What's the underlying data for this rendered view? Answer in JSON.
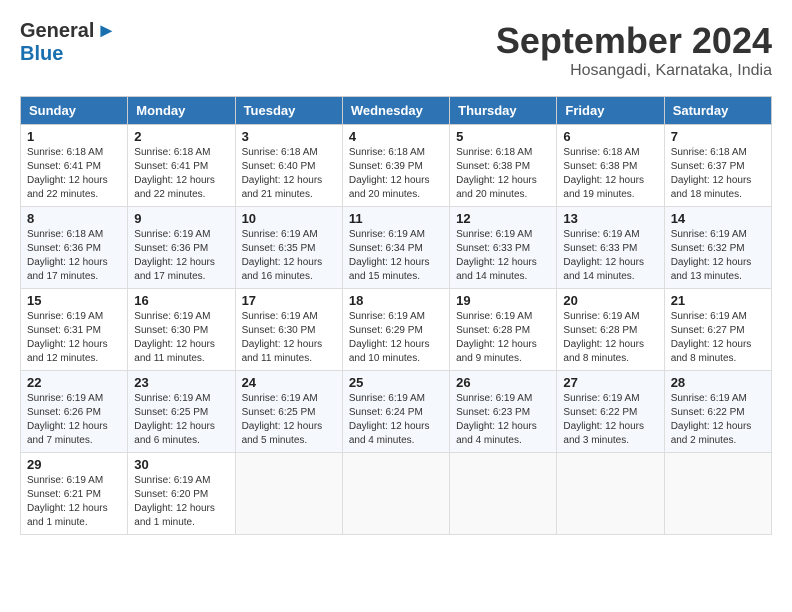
{
  "logo": {
    "general": "General",
    "blue": "Blue"
  },
  "title": "September 2024",
  "location": "Hosangadi, Karnataka, India",
  "headers": [
    "Sunday",
    "Monday",
    "Tuesday",
    "Wednesday",
    "Thursday",
    "Friday",
    "Saturday"
  ],
  "weeks": [
    [
      {
        "day": "1",
        "sunrise": "6:18 AM",
        "sunset": "6:41 PM",
        "daylight": "12 hours and 22 minutes."
      },
      {
        "day": "2",
        "sunrise": "6:18 AM",
        "sunset": "6:41 PM",
        "daylight": "12 hours and 22 minutes."
      },
      {
        "day": "3",
        "sunrise": "6:18 AM",
        "sunset": "6:40 PM",
        "daylight": "12 hours and 21 minutes."
      },
      {
        "day": "4",
        "sunrise": "6:18 AM",
        "sunset": "6:39 PM",
        "daylight": "12 hours and 20 minutes."
      },
      {
        "day": "5",
        "sunrise": "6:18 AM",
        "sunset": "6:38 PM",
        "daylight": "12 hours and 20 minutes."
      },
      {
        "day": "6",
        "sunrise": "6:18 AM",
        "sunset": "6:38 PM",
        "daylight": "12 hours and 19 minutes."
      },
      {
        "day": "7",
        "sunrise": "6:18 AM",
        "sunset": "6:37 PM",
        "daylight": "12 hours and 18 minutes."
      }
    ],
    [
      {
        "day": "8",
        "sunrise": "6:18 AM",
        "sunset": "6:36 PM",
        "daylight": "12 hours and 17 minutes."
      },
      {
        "day": "9",
        "sunrise": "6:19 AM",
        "sunset": "6:36 PM",
        "daylight": "12 hours and 17 minutes."
      },
      {
        "day": "10",
        "sunrise": "6:19 AM",
        "sunset": "6:35 PM",
        "daylight": "12 hours and 16 minutes."
      },
      {
        "day": "11",
        "sunrise": "6:19 AM",
        "sunset": "6:34 PM",
        "daylight": "12 hours and 15 minutes."
      },
      {
        "day": "12",
        "sunrise": "6:19 AM",
        "sunset": "6:33 PM",
        "daylight": "12 hours and 14 minutes."
      },
      {
        "day": "13",
        "sunrise": "6:19 AM",
        "sunset": "6:33 PM",
        "daylight": "12 hours and 14 minutes."
      },
      {
        "day": "14",
        "sunrise": "6:19 AM",
        "sunset": "6:32 PM",
        "daylight": "12 hours and 13 minutes."
      }
    ],
    [
      {
        "day": "15",
        "sunrise": "6:19 AM",
        "sunset": "6:31 PM",
        "daylight": "12 hours and 12 minutes."
      },
      {
        "day": "16",
        "sunrise": "6:19 AM",
        "sunset": "6:30 PM",
        "daylight": "12 hours and 11 minutes."
      },
      {
        "day": "17",
        "sunrise": "6:19 AM",
        "sunset": "6:30 PM",
        "daylight": "12 hours and 11 minutes."
      },
      {
        "day": "18",
        "sunrise": "6:19 AM",
        "sunset": "6:29 PM",
        "daylight": "12 hours and 10 minutes."
      },
      {
        "day": "19",
        "sunrise": "6:19 AM",
        "sunset": "6:28 PM",
        "daylight": "12 hours and 9 minutes."
      },
      {
        "day": "20",
        "sunrise": "6:19 AM",
        "sunset": "6:28 PM",
        "daylight": "12 hours and 8 minutes."
      },
      {
        "day": "21",
        "sunrise": "6:19 AM",
        "sunset": "6:27 PM",
        "daylight": "12 hours and 8 minutes."
      }
    ],
    [
      {
        "day": "22",
        "sunrise": "6:19 AM",
        "sunset": "6:26 PM",
        "daylight": "12 hours and 7 minutes."
      },
      {
        "day": "23",
        "sunrise": "6:19 AM",
        "sunset": "6:25 PM",
        "daylight": "12 hours and 6 minutes."
      },
      {
        "day": "24",
        "sunrise": "6:19 AM",
        "sunset": "6:25 PM",
        "daylight": "12 hours and 5 minutes."
      },
      {
        "day": "25",
        "sunrise": "6:19 AM",
        "sunset": "6:24 PM",
        "daylight": "12 hours and 4 minutes."
      },
      {
        "day": "26",
        "sunrise": "6:19 AM",
        "sunset": "6:23 PM",
        "daylight": "12 hours and 4 minutes."
      },
      {
        "day": "27",
        "sunrise": "6:19 AM",
        "sunset": "6:22 PM",
        "daylight": "12 hours and 3 minutes."
      },
      {
        "day": "28",
        "sunrise": "6:19 AM",
        "sunset": "6:22 PM",
        "daylight": "12 hours and 2 minutes."
      }
    ],
    [
      {
        "day": "29",
        "sunrise": "6:19 AM",
        "sunset": "6:21 PM",
        "daylight": "12 hours and 1 minute."
      },
      {
        "day": "30",
        "sunrise": "6:19 AM",
        "sunset": "6:20 PM",
        "daylight": "12 hours and 1 minute."
      },
      null,
      null,
      null,
      null,
      null
    ]
  ],
  "labels": {
    "sunrise": "Sunrise:",
    "sunset": "Sunset:",
    "daylight": "Daylight:"
  }
}
